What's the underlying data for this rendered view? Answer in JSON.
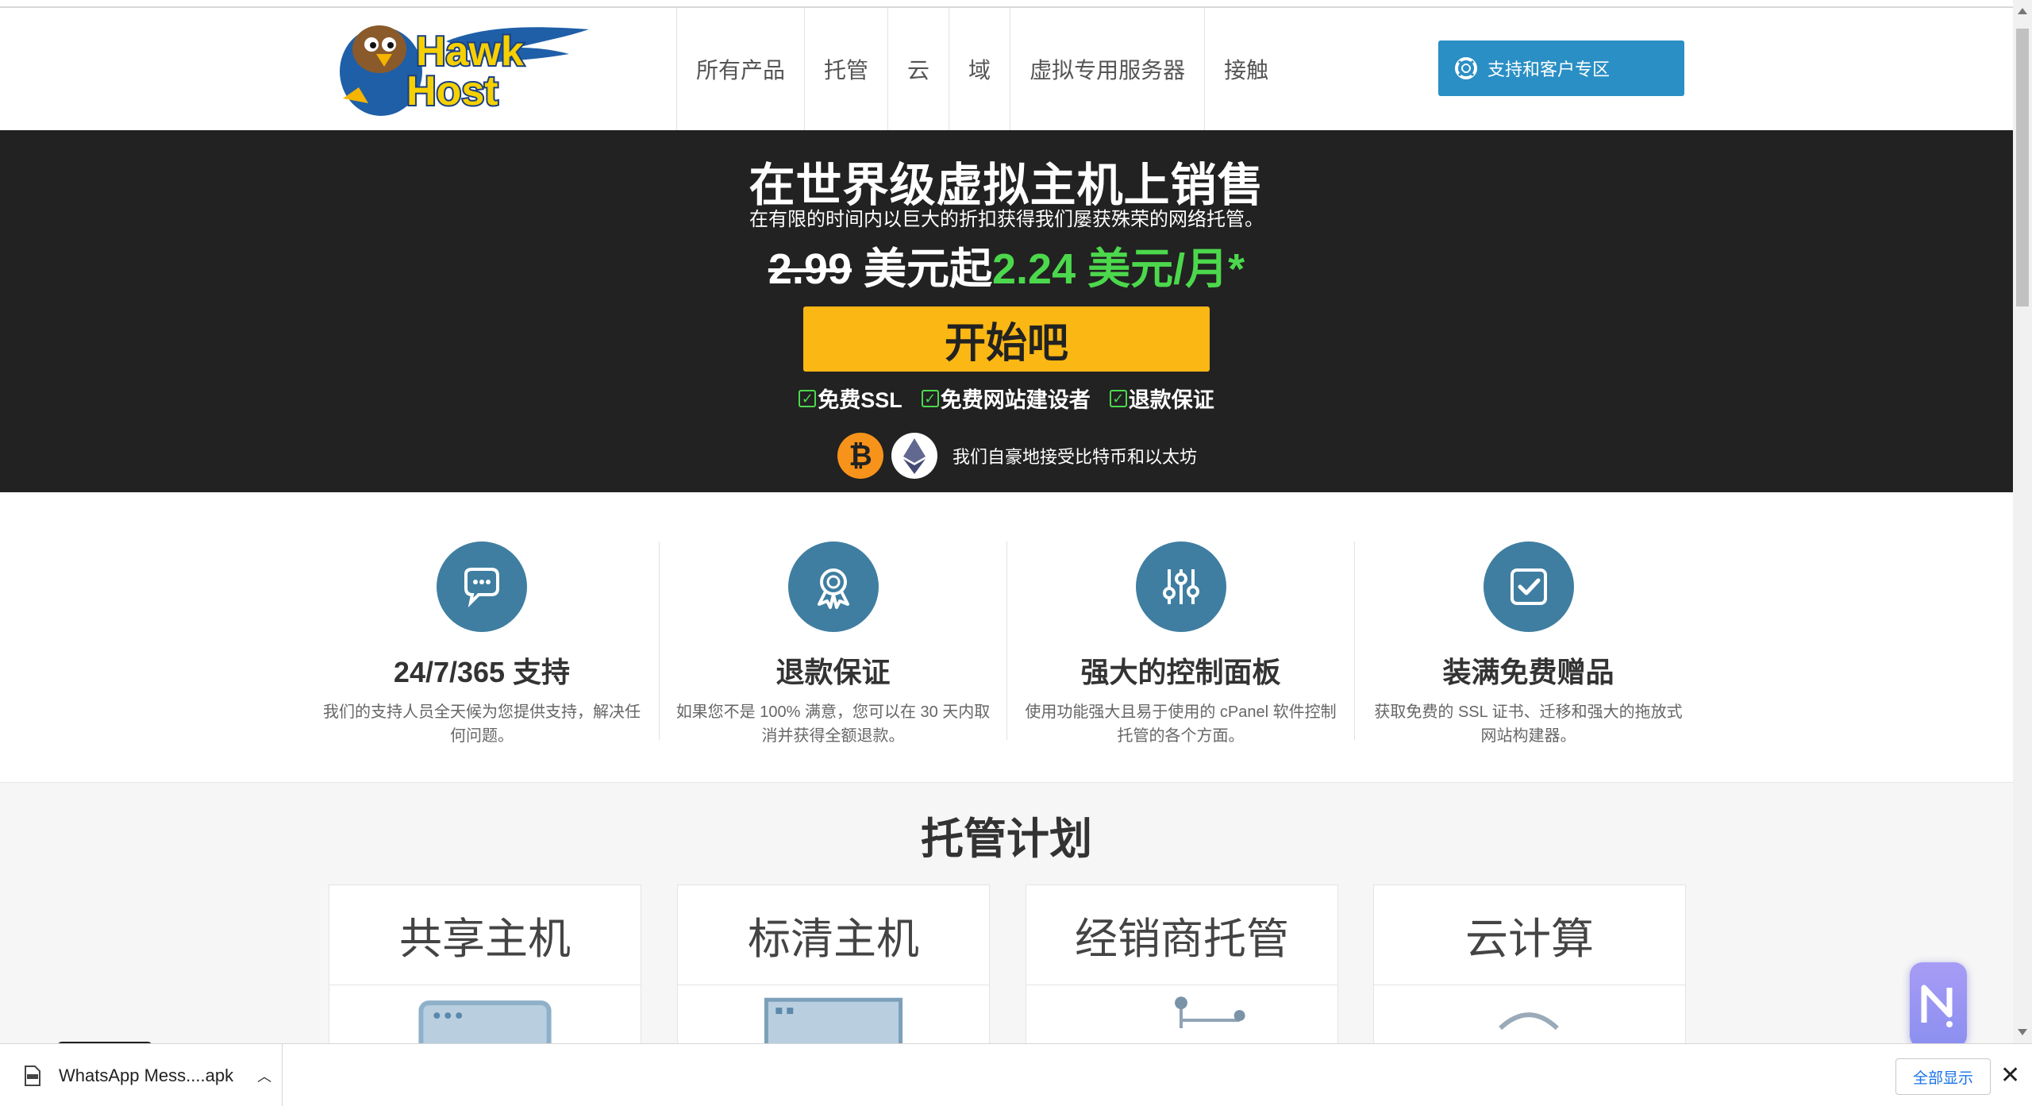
{
  "nav": {
    "items": [
      "所有产品",
      "托管",
      "云",
      "域",
      "虚拟专用服务器",
      "接触"
    ],
    "support_label": "支持和客户专区"
  },
  "hero": {
    "title": "在世界级虚拟主机上销售",
    "subtitle": "在有限的时间内以巨大的折扣获得我们屡获殊荣的网络托管。",
    "old_price": "2.99",
    "price_mid": " 美元起",
    "new_price": "2.24 美元/月*",
    "cta": "开始吧",
    "features": [
      "免费SSL",
      "免费网站建设者",
      "退款保证"
    ],
    "crypto_text": "我们自豪地接受比特币和以太坊"
  },
  "features": [
    {
      "title": "24/7/365 支持",
      "desc": "我们的支持人员全天候为您提供支持，解决任何问题。",
      "icon": "chat-icon"
    },
    {
      "title": "退款保证",
      "desc": "如果您不是 100% 满意，您可以在 30 天内取消并获得全额退款。",
      "icon": "award-icon"
    },
    {
      "title": "强大的控制面板",
      "desc": "使用功能强大且易于使用的 cPanel 软件控制托管的各个方面。",
      "icon": "sliders-icon"
    },
    {
      "title": "装满免费赠品",
      "desc": "获取免费的 SSL 证书、迁移和强大的拖放式网站构建器。",
      "icon": "checkbox-icon"
    }
  ],
  "plans": {
    "title": "托管计划",
    "items": [
      "共享主机",
      "标清主机",
      "经销商托管",
      "云计算"
    ]
  },
  "downloads": {
    "file": "WhatsApp Mess....apk",
    "show_all": "全部显示"
  },
  "colors": {
    "accent_blue": "#2a8fc4",
    "icon_blue": "#3f7ea1",
    "cta_yellow": "#fbb713",
    "price_green": "#4cd84c",
    "hero_bg": "#222222"
  }
}
